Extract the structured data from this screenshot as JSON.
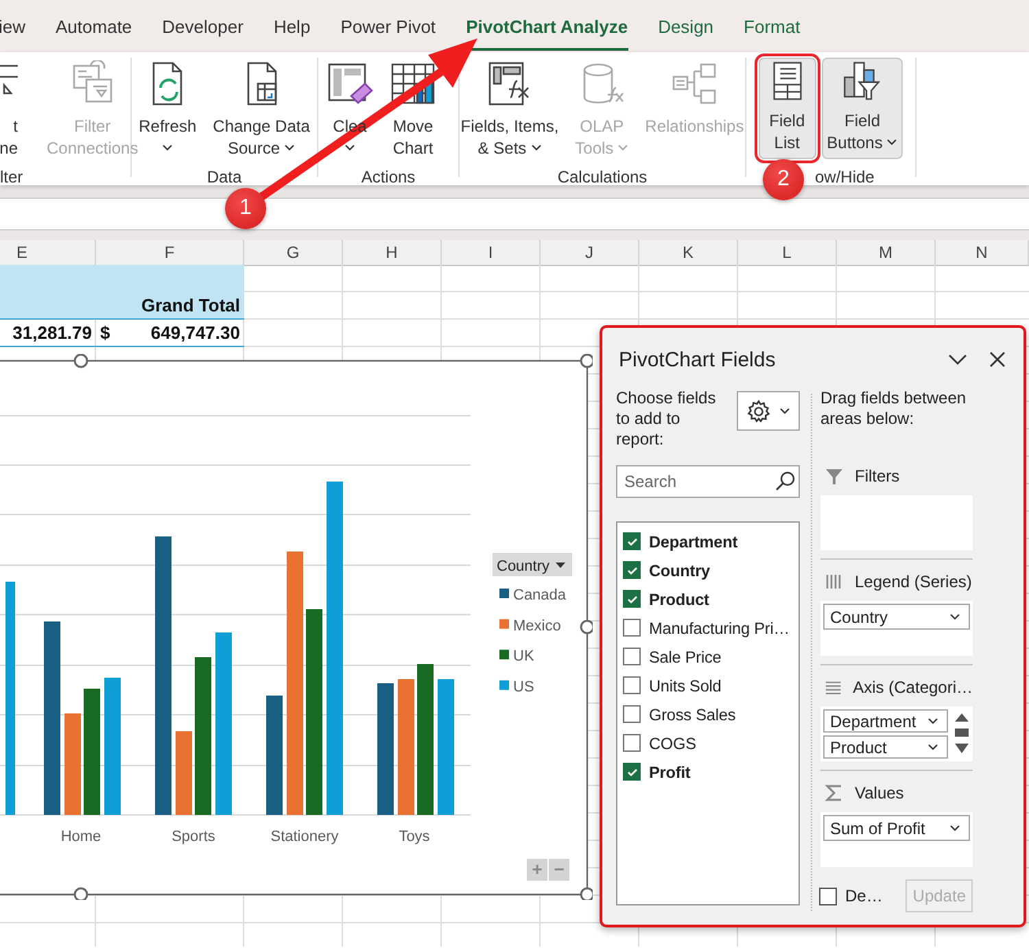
{
  "tabs": [
    {
      "label": "iew",
      "kind": "standard",
      "selected": false
    },
    {
      "label": "Automate",
      "kind": "standard",
      "selected": false
    },
    {
      "label": "Developer",
      "kind": "standard",
      "selected": false
    },
    {
      "label": "Help",
      "kind": "standard",
      "selected": false
    },
    {
      "label": "Power Pivot",
      "kind": "standard",
      "selected": false
    },
    {
      "label": "PivotChart Analyze",
      "kind": "contextual",
      "selected": true
    },
    {
      "label": "Design",
      "kind": "contextual",
      "selected": false
    },
    {
      "label": "Format",
      "kind": "contextual",
      "selected": false
    }
  ],
  "ribbon": {
    "groups": [
      {
        "label": "lter",
        "buttons": [
          {
            "lines": [
              "t",
              "ne"
            ],
            "dropdown": false,
            "disabled": false,
            "pressed": false,
            "highlighted": false
          },
          {
            "lines": [
              "Filter",
              "Connections"
            ],
            "dropdown": false,
            "disabled": true,
            "pressed": false,
            "highlighted": false
          }
        ]
      },
      {
        "label": "Data",
        "buttons": [
          {
            "lines": [
              "Refresh"
            ],
            "dropdown": true,
            "disabled": false,
            "pressed": false,
            "highlighted": false
          },
          {
            "lines": [
              "Change Data",
              "Source"
            ],
            "dropdown": true,
            "disabled": false,
            "pressed": false,
            "highlighted": false
          }
        ]
      },
      {
        "label": "Actions",
        "buttons": [
          {
            "lines": [
              "Clea"
            ],
            "dropdown": true,
            "disabled": false,
            "pressed": false,
            "highlighted": false
          },
          {
            "lines": [
              "Move",
              "Chart"
            ],
            "dropdown": false,
            "disabled": false,
            "pressed": false,
            "highlighted": false
          }
        ]
      },
      {
        "label": "Calculations",
        "buttons": [
          {
            "lines": [
              "Fields, Items,",
              "& Sets"
            ],
            "dropdown": true,
            "disabled": false,
            "pressed": false,
            "highlighted": false
          },
          {
            "lines": [
              "OLAP",
              "Tools"
            ],
            "dropdown": true,
            "disabled": true,
            "pressed": false,
            "highlighted": false
          },
          {
            "lines": [
              "Relationships"
            ],
            "dropdown": false,
            "disabled": true,
            "pressed": false,
            "highlighted": false
          }
        ]
      },
      {
        "label": "ow/Hide",
        "buttons": [
          {
            "lines": [
              "Field",
              "List"
            ],
            "dropdown": false,
            "disabled": false,
            "pressed": true,
            "highlighted": true
          },
          {
            "lines": [
              "Field",
              "Buttons"
            ],
            "dropdown": true,
            "disabled": false,
            "pressed": true,
            "highlighted": false
          }
        ]
      }
    ]
  },
  "sheet": {
    "columns": [
      "E",
      "F",
      "G",
      "H",
      "I",
      "J",
      "K",
      "L",
      "M",
      "N"
    ],
    "pivot_header": "Grand Total",
    "total_row": {
      "column_e": "31,281.79",
      "currency": "$",
      "column_f": "649,747.30"
    }
  },
  "chart": {
    "categories": [
      "Home",
      "Sports",
      "Stationery",
      "Toys"
    ],
    "legend": {
      "field": "Country",
      "series": [
        {
          "name": "Canada",
          "color": "#185f83"
        },
        {
          "name": "Mexico",
          "color": "#e97132"
        },
        {
          "name": "UK",
          "color": "#196b24"
        },
        {
          "name": "US",
          "color": "#0f9ed5"
        }
      ]
    },
    "zoom_buttons": [
      "+",
      "−"
    ]
  },
  "field_pane": {
    "title": "PivotChart Fields",
    "choose_label": "Choose fields to add to report:",
    "search": {
      "placeholder": "Search"
    },
    "fields": [
      {
        "name": "Department",
        "checked": true
      },
      {
        "name": "Country",
        "checked": true
      },
      {
        "name": "Product",
        "checked": true
      },
      {
        "name": "Manufacturing Pri…",
        "checked": false
      },
      {
        "name": "Sale Price",
        "checked": false
      },
      {
        "name": "Units Sold",
        "checked": false
      },
      {
        "name": "Gross Sales",
        "checked": false
      },
      {
        "name": "COGS",
        "checked": false
      },
      {
        "name": "Profit",
        "checked": true
      }
    ],
    "areas_hint": "Drag fields between areas below:",
    "areas": [
      {
        "kind": "filters",
        "label": "Filters"
      },
      {
        "kind": "legend",
        "label": "Legend (Series)",
        "items": [
          "Country"
        ]
      },
      {
        "kind": "axis",
        "label": "Axis (Categori…",
        "items": [
          "Department",
          "Product"
        ]
      },
      {
        "kind": "values",
        "label": "Values",
        "items": [
          "Sum of Profit"
        ]
      }
    ],
    "defer": {
      "label": "De…",
      "checked": false
    },
    "update_button": {
      "label": "Update",
      "disabled": true
    }
  },
  "annotations": [
    {
      "label": "1"
    },
    {
      "label": "2"
    }
  ]
}
